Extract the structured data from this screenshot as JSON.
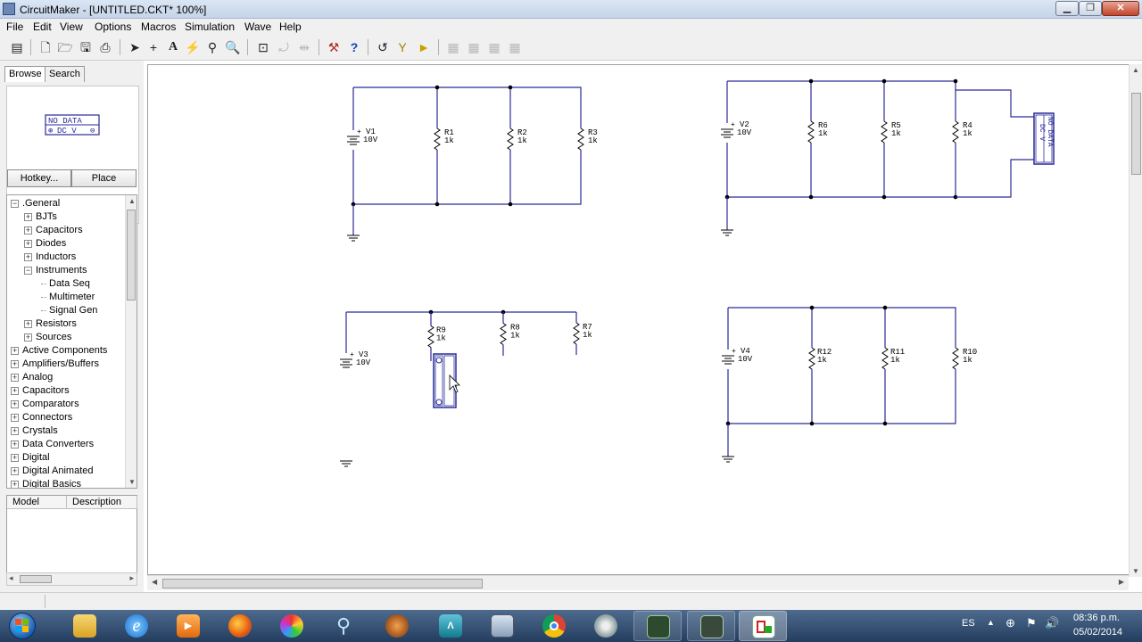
{
  "window": {
    "title": "CircuitMaker - [UNTITLED.CKT* 100%]"
  },
  "menu": [
    "File",
    "Edit",
    "View",
    "Options",
    "Macros",
    "Simulation",
    "Wave",
    "Help"
  ],
  "left_panel": {
    "tabs": [
      "Browse",
      "Search"
    ],
    "preview": {
      "line1": "NO DATA",
      "line2": "DC V"
    },
    "hotkey_label": "Hotkey...",
    "place_label": "Place",
    "tree": [
      {
        "label": ".General",
        "level": 0,
        "expander": "−"
      },
      {
        "label": "BJTs",
        "level": 1,
        "expander": "+"
      },
      {
        "label": "Capacitors",
        "level": 1,
        "expander": "+"
      },
      {
        "label": "Diodes",
        "level": 1,
        "expander": "+"
      },
      {
        "label": "Inductors",
        "level": 1,
        "expander": "+"
      },
      {
        "label": "Instruments",
        "level": 1,
        "expander": "−"
      },
      {
        "label": "Data Seq",
        "level": 2,
        "expander": ""
      },
      {
        "label": "Multimeter",
        "level": 2,
        "expander": "",
        "selected": true
      },
      {
        "label": "Signal Gen",
        "level": 2,
        "expander": ""
      },
      {
        "label": "Resistors",
        "level": 1,
        "expander": "+"
      },
      {
        "label": "Sources",
        "level": 1,
        "expander": "+"
      },
      {
        "label": "Active Components",
        "level": 0,
        "expander": "+"
      },
      {
        "label": "Amplifiers/Buffers",
        "level": 0,
        "expander": "+"
      },
      {
        "label": "Analog",
        "level": 0,
        "expander": "+"
      },
      {
        "label": "Capacitors",
        "level": 0,
        "expander": "+"
      },
      {
        "label": "Comparators",
        "level": 0,
        "expander": "+"
      },
      {
        "label": "Connectors",
        "level": 0,
        "expander": "+"
      },
      {
        "label": "Crystals",
        "level": 0,
        "expander": "+"
      },
      {
        "label": "Data Converters",
        "level": 0,
        "expander": "+"
      },
      {
        "label": "Digital",
        "level": 0,
        "expander": "+"
      },
      {
        "label": "Digital Animated",
        "level": 0,
        "expander": "+"
      },
      {
        "label": "Digital Basics",
        "level": 0,
        "expander": "+"
      }
    ],
    "model_table": {
      "col_model": "Model",
      "col_description": "Description"
    }
  },
  "schematic": {
    "sources": [
      {
        "name": "V1",
        "value": "10V"
      },
      {
        "name": "V2",
        "value": "10V"
      },
      {
        "name": "V3",
        "value": "10V"
      },
      {
        "name": "V4",
        "value": "10V"
      }
    ],
    "resistors": [
      {
        "name": "R1",
        "value": "1k"
      },
      {
        "name": "R2",
        "value": "1k"
      },
      {
        "name": "R3",
        "value": "1k"
      },
      {
        "name": "R4",
        "value": "1k"
      },
      {
        "name": "R5",
        "value": "1k"
      },
      {
        "name": "R6",
        "value": "1k"
      },
      {
        "name": "R7",
        "value": "1k"
      },
      {
        "name": "R8",
        "value": "1k"
      },
      {
        "name": "R9",
        "value": "1k"
      },
      {
        "name": "R10",
        "value": "1k"
      },
      {
        "name": "R11",
        "value": "1k"
      },
      {
        "name": "R12",
        "value": "1k"
      }
    ],
    "meter": {
      "line1": "NO DATA",
      "line2": "DC V"
    }
  },
  "tray": {
    "lang": "ES",
    "time": "08:36 p.m.",
    "date": "05/02/2014"
  },
  "colors": {
    "wire": "#2a2a9a",
    "component": "#000000",
    "node": "#000000",
    "taskbar": "#2f4c70"
  },
  "taskbar_icons": [
    "start-orb-icon",
    "file-explorer-icon",
    "internet-explorer-icon",
    "media-player-icon",
    "firefox-icon",
    "paint-icon",
    "search-icon",
    "app-icon",
    "arduino-icon",
    "calculator-icon",
    "chrome-icon",
    "disk-icon",
    "circuit-app-icon",
    "circuit-app-2-icon",
    "circuitmaker-icon"
  ]
}
